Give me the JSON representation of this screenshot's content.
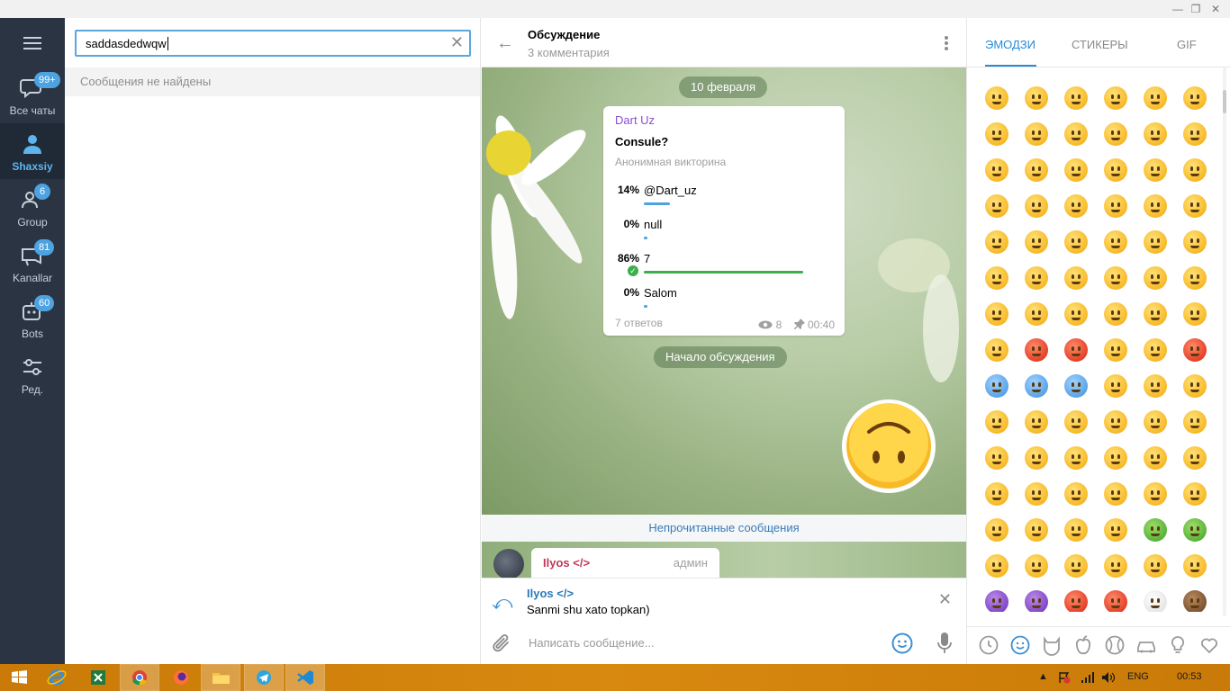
{
  "window": {
    "controls": [
      "minimize",
      "maximize",
      "close"
    ]
  },
  "folders": [
    {
      "label": "Все чаты",
      "badge": "99+",
      "icon": "chats-icon",
      "active": false
    },
    {
      "label": "Shaxsiy",
      "badge": "",
      "icon": "person-icon",
      "active": true
    },
    {
      "label": "Group",
      "badge": "6",
      "icon": "group-icon",
      "active": false
    },
    {
      "label": "Kanallar",
      "badge": "81",
      "icon": "channel-icon",
      "active": false
    },
    {
      "label": "Bots",
      "badge": "60",
      "icon": "bot-icon",
      "active": false
    },
    {
      "label": "Ред.",
      "badge": "",
      "icon": "settings-sliders-icon",
      "active": false
    }
  ],
  "search": {
    "value": "saddasdedwqw",
    "no_results": "Сообщения не найдены"
  },
  "chat": {
    "title": "Обсуждение",
    "subtitle": "3 комментария",
    "date_pill": "10 февраля",
    "poll": {
      "author": "Dart Uz",
      "question": "Consule?",
      "type": "Анонимная викторина",
      "options": [
        {
          "percent": "14%",
          "text": "@Dart_uz",
          "share": 14,
          "correct": false
        },
        {
          "percent": "0%",
          "text": "null",
          "share": 0,
          "correct": false
        },
        {
          "percent": "86%",
          "text": "7",
          "share": 86,
          "correct": true
        },
        {
          "percent": "0%",
          "text": "Salom",
          "share": 0,
          "correct": false
        }
      ],
      "votes": "7 ответов",
      "views": "8",
      "time": "00:40"
    },
    "discussion_start": "Начало обсуждения",
    "unread": "Непрочитанные сообщения",
    "last_message": {
      "name": "Ilyos </>",
      "role": "админ"
    },
    "reply": {
      "name": "Ilyos </>",
      "text": "Sanmi shu xato topkan)"
    },
    "composer_placeholder": "Написать сообщение..."
  },
  "emoji_panel": {
    "tabs": [
      "ЭМОДЗИ",
      "СТИКЕРЫ",
      "GIF"
    ],
    "active_tab": "ЭМОДЗИ",
    "categories": [
      "recent-icon",
      "smileys-icon",
      "animals-icon",
      "food-icon",
      "sports-icon",
      "travel-icon",
      "objects-icon",
      "symbols-icon"
    ]
  },
  "taskbar": {
    "apps": [
      "start-icon",
      "ie-icon",
      "excel-icon",
      "chrome-icon",
      "firefox-icon",
      "explorer-icon",
      "telegram-icon",
      "vscode-icon"
    ],
    "language": "ENG",
    "clock": "00:53"
  },
  "colors": {
    "sidebar": "#2a3442",
    "accent": "#4da2e0",
    "poll_win": "#3cae4c",
    "taskbar": "#d8890f"
  }
}
